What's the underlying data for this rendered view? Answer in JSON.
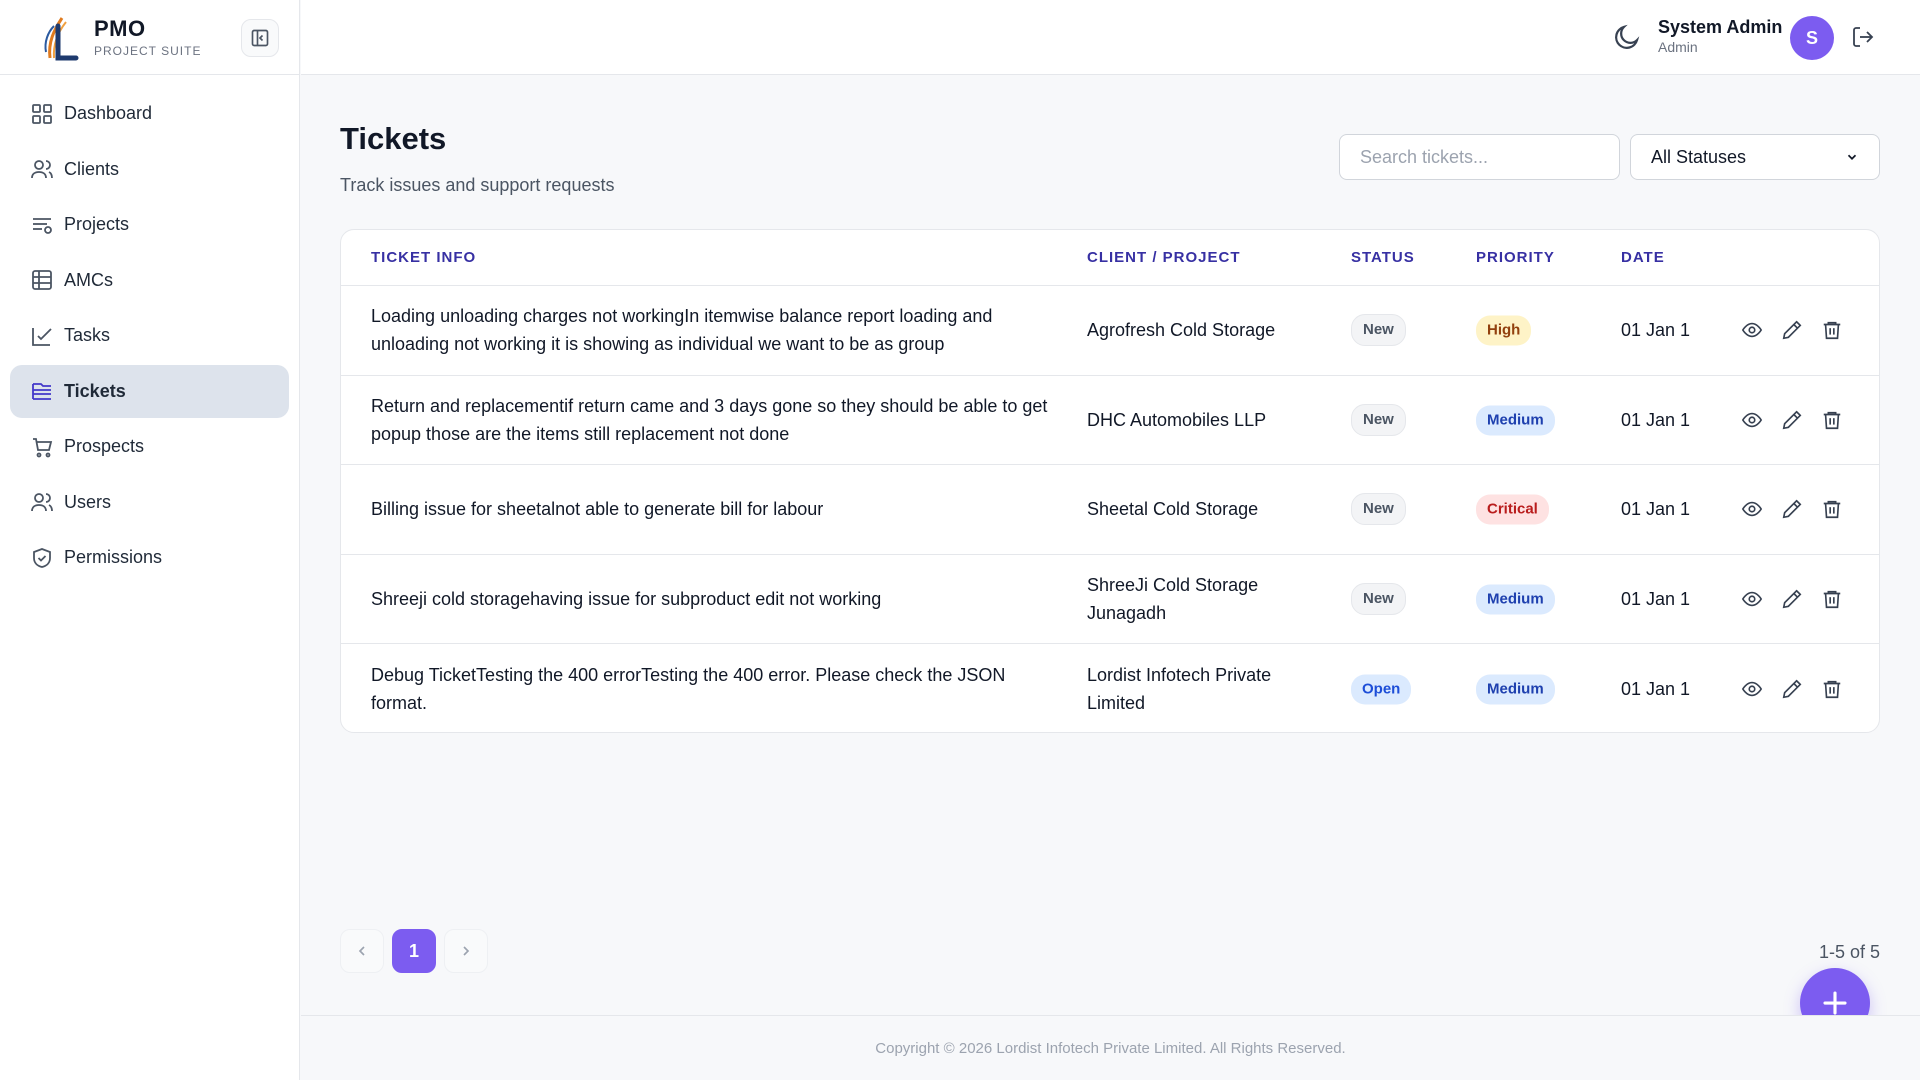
{
  "brand": {
    "title": "PMO",
    "subtitle": "PROJECT SUITE"
  },
  "sidebar": {
    "items": [
      {
        "label": "Dashboard",
        "icon": "dashboard-grid-icon"
      },
      {
        "label": "Clients",
        "icon": "users-icon"
      },
      {
        "label": "Projects",
        "icon": "projects-list-icon"
      },
      {
        "label": "AMCs",
        "icon": "table-icon"
      },
      {
        "label": "Tasks",
        "icon": "checkbox-icon"
      },
      {
        "label": "Tickets",
        "icon": "tickets-icon",
        "active": true
      },
      {
        "label": "Prospects",
        "icon": "cart-icon"
      },
      {
        "label": "Users",
        "icon": "users-icon"
      },
      {
        "label": "Permissions",
        "icon": "shield-check-icon"
      }
    ]
  },
  "header": {
    "user_name": "System Admin",
    "user_role": "Admin",
    "avatar_initial": "S"
  },
  "page": {
    "title": "Tickets",
    "subtitle": "Track issues and support requests",
    "search_placeholder": "Search tickets...",
    "status_filter": "All Statuses"
  },
  "table": {
    "columns": [
      "TICKET INFO",
      "CLIENT / PROJECT",
      "STATUS",
      "PRIORITY",
      "DATE"
    ],
    "rows": [
      {
        "info": "Loading unloading charges not workingIn itemwise balance report loading and unloading not working it is showing as individual we want to be as group",
        "client": "Agrofresh Cold Storage",
        "status": "New",
        "priority": "High",
        "date": "01 Jan 1"
      },
      {
        "info": "Return and replacementif return came and 3 days gone so they should be able to get popup those are the items still replacement not done",
        "client": "DHC Automobiles LLP",
        "status": "New",
        "priority": "Medium",
        "date": "01 Jan 1"
      },
      {
        "info": "Billing issue for sheetalnot able to generate bill for labour",
        "client": "Sheetal Cold Storage",
        "status": "New",
        "priority": "Critical",
        "date": "01 Jan 1"
      },
      {
        "info": "Shreeji cold storagehaving issue for subproduct edit not working",
        "client": "ShreeJi Cold Storage Junagadh",
        "status": "New",
        "priority": "Medium",
        "date": "01 Jan 1"
      },
      {
        "info": "Debug TicketTesting the 400 errorTesting the 400 error. Please check the JSON format.",
        "client": "Lordist Infotech Private Limited",
        "status": "Open",
        "priority": "Medium",
        "date": "01 Jan 1"
      }
    ]
  },
  "pagination": {
    "current_page": "1",
    "range_text": "1-5 of 5"
  },
  "footer": {
    "copyright": "Copyright © 2026 Lordist Infotech Private Limited. All Rights Reserved."
  },
  "colors": {
    "accent": "#7c5cf0",
    "active_nav_bg": "#dde3ec",
    "header_text": "#3730a3"
  }
}
